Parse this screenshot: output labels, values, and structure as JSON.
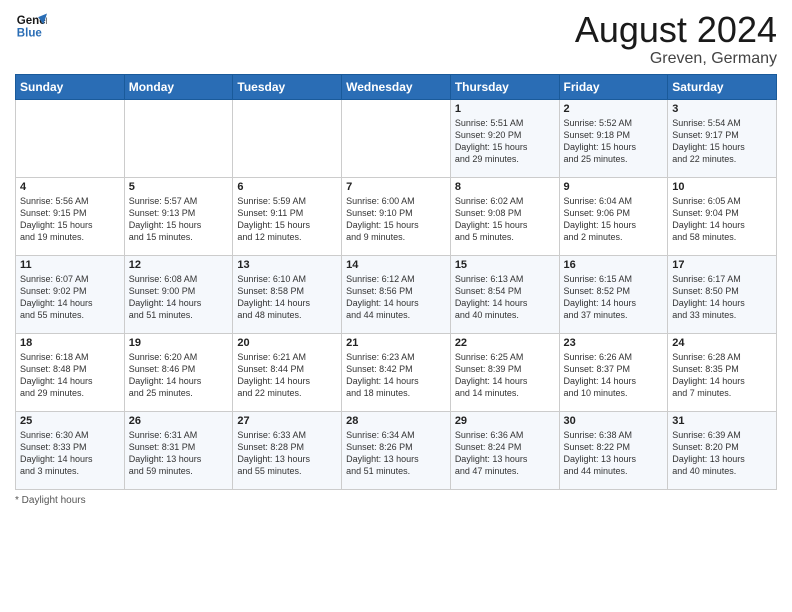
{
  "header": {
    "logo_line1": "General",
    "logo_line2": "Blue",
    "month_title": "August 2024",
    "location": "Greven, Germany"
  },
  "footer": {
    "note": "Daylight hours"
  },
  "days_of_week": [
    "Sunday",
    "Monday",
    "Tuesday",
    "Wednesday",
    "Thursday",
    "Friday",
    "Saturday"
  ],
  "weeks": [
    [
      {
        "day": "",
        "info": ""
      },
      {
        "day": "",
        "info": ""
      },
      {
        "day": "",
        "info": ""
      },
      {
        "day": "",
        "info": ""
      },
      {
        "day": "1",
        "info": "Sunrise: 5:51 AM\nSunset: 9:20 PM\nDaylight: 15 hours\nand 29 minutes."
      },
      {
        "day": "2",
        "info": "Sunrise: 5:52 AM\nSunset: 9:18 PM\nDaylight: 15 hours\nand 25 minutes."
      },
      {
        "day": "3",
        "info": "Sunrise: 5:54 AM\nSunset: 9:17 PM\nDaylight: 15 hours\nand 22 minutes."
      }
    ],
    [
      {
        "day": "4",
        "info": "Sunrise: 5:56 AM\nSunset: 9:15 PM\nDaylight: 15 hours\nand 19 minutes."
      },
      {
        "day": "5",
        "info": "Sunrise: 5:57 AM\nSunset: 9:13 PM\nDaylight: 15 hours\nand 15 minutes."
      },
      {
        "day": "6",
        "info": "Sunrise: 5:59 AM\nSunset: 9:11 PM\nDaylight: 15 hours\nand 12 minutes."
      },
      {
        "day": "7",
        "info": "Sunrise: 6:00 AM\nSunset: 9:10 PM\nDaylight: 15 hours\nand 9 minutes."
      },
      {
        "day": "8",
        "info": "Sunrise: 6:02 AM\nSunset: 9:08 PM\nDaylight: 15 hours\nand 5 minutes."
      },
      {
        "day": "9",
        "info": "Sunrise: 6:04 AM\nSunset: 9:06 PM\nDaylight: 15 hours\nand 2 minutes."
      },
      {
        "day": "10",
        "info": "Sunrise: 6:05 AM\nSunset: 9:04 PM\nDaylight: 14 hours\nand 58 minutes."
      }
    ],
    [
      {
        "day": "11",
        "info": "Sunrise: 6:07 AM\nSunset: 9:02 PM\nDaylight: 14 hours\nand 55 minutes."
      },
      {
        "day": "12",
        "info": "Sunrise: 6:08 AM\nSunset: 9:00 PM\nDaylight: 14 hours\nand 51 minutes."
      },
      {
        "day": "13",
        "info": "Sunrise: 6:10 AM\nSunset: 8:58 PM\nDaylight: 14 hours\nand 48 minutes."
      },
      {
        "day": "14",
        "info": "Sunrise: 6:12 AM\nSunset: 8:56 PM\nDaylight: 14 hours\nand 44 minutes."
      },
      {
        "day": "15",
        "info": "Sunrise: 6:13 AM\nSunset: 8:54 PM\nDaylight: 14 hours\nand 40 minutes."
      },
      {
        "day": "16",
        "info": "Sunrise: 6:15 AM\nSunset: 8:52 PM\nDaylight: 14 hours\nand 37 minutes."
      },
      {
        "day": "17",
        "info": "Sunrise: 6:17 AM\nSunset: 8:50 PM\nDaylight: 14 hours\nand 33 minutes."
      }
    ],
    [
      {
        "day": "18",
        "info": "Sunrise: 6:18 AM\nSunset: 8:48 PM\nDaylight: 14 hours\nand 29 minutes."
      },
      {
        "day": "19",
        "info": "Sunrise: 6:20 AM\nSunset: 8:46 PM\nDaylight: 14 hours\nand 25 minutes."
      },
      {
        "day": "20",
        "info": "Sunrise: 6:21 AM\nSunset: 8:44 PM\nDaylight: 14 hours\nand 22 minutes."
      },
      {
        "day": "21",
        "info": "Sunrise: 6:23 AM\nSunset: 8:42 PM\nDaylight: 14 hours\nand 18 minutes."
      },
      {
        "day": "22",
        "info": "Sunrise: 6:25 AM\nSunset: 8:39 PM\nDaylight: 14 hours\nand 14 minutes."
      },
      {
        "day": "23",
        "info": "Sunrise: 6:26 AM\nSunset: 8:37 PM\nDaylight: 14 hours\nand 10 minutes."
      },
      {
        "day": "24",
        "info": "Sunrise: 6:28 AM\nSunset: 8:35 PM\nDaylight: 14 hours\nand 7 minutes."
      }
    ],
    [
      {
        "day": "25",
        "info": "Sunrise: 6:30 AM\nSunset: 8:33 PM\nDaylight: 14 hours\nand 3 minutes."
      },
      {
        "day": "26",
        "info": "Sunrise: 6:31 AM\nSunset: 8:31 PM\nDaylight: 13 hours\nand 59 minutes."
      },
      {
        "day": "27",
        "info": "Sunrise: 6:33 AM\nSunset: 8:28 PM\nDaylight: 13 hours\nand 55 minutes."
      },
      {
        "day": "28",
        "info": "Sunrise: 6:34 AM\nSunset: 8:26 PM\nDaylight: 13 hours\nand 51 minutes."
      },
      {
        "day": "29",
        "info": "Sunrise: 6:36 AM\nSunset: 8:24 PM\nDaylight: 13 hours\nand 47 minutes."
      },
      {
        "day": "30",
        "info": "Sunrise: 6:38 AM\nSunset: 8:22 PM\nDaylight: 13 hours\nand 44 minutes."
      },
      {
        "day": "31",
        "info": "Sunrise: 6:39 AM\nSunset: 8:20 PM\nDaylight: 13 hours\nand 40 minutes."
      }
    ]
  ]
}
